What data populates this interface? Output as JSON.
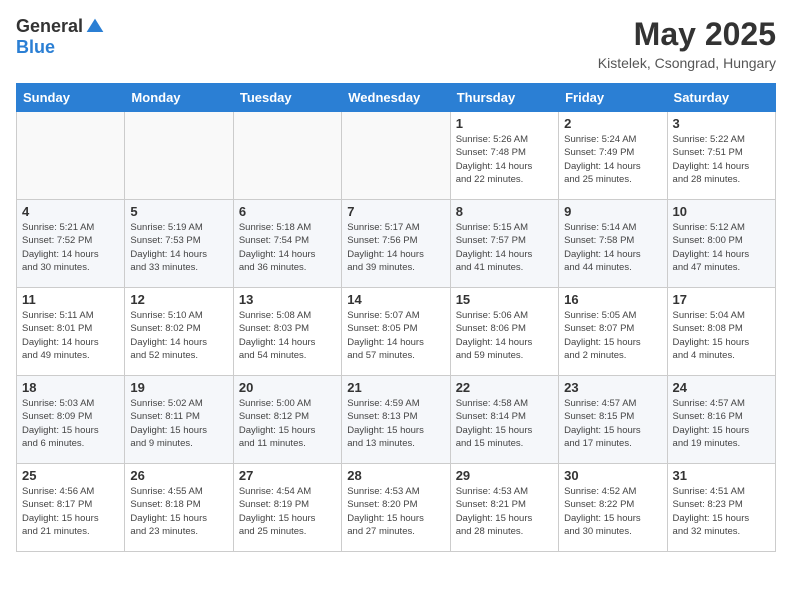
{
  "header": {
    "logo_general": "General",
    "logo_blue": "Blue",
    "month_title": "May 2025",
    "location": "Kistelek, Csongrad, Hungary"
  },
  "weekdays": [
    "Sunday",
    "Monday",
    "Tuesday",
    "Wednesday",
    "Thursday",
    "Friday",
    "Saturday"
  ],
  "weeks": [
    [
      {
        "day": "",
        "info": ""
      },
      {
        "day": "",
        "info": ""
      },
      {
        "day": "",
        "info": ""
      },
      {
        "day": "",
        "info": ""
      },
      {
        "day": "1",
        "info": "Sunrise: 5:26 AM\nSunset: 7:48 PM\nDaylight: 14 hours\nand 22 minutes."
      },
      {
        "day": "2",
        "info": "Sunrise: 5:24 AM\nSunset: 7:49 PM\nDaylight: 14 hours\nand 25 minutes."
      },
      {
        "day": "3",
        "info": "Sunrise: 5:22 AM\nSunset: 7:51 PM\nDaylight: 14 hours\nand 28 minutes."
      }
    ],
    [
      {
        "day": "4",
        "info": "Sunrise: 5:21 AM\nSunset: 7:52 PM\nDaylight: 14 hours\nand 30 minutes."
      },
      {
        "day": "5",
        "info": "Sunrise: 5:19 AM\nSunset: 7:53 PM\nDaylight: 14 hours\nand 33 minutes."
      },
      {
        "day": "6",
        "info": "Sunrise: 5:18 AM\nSunset: 7:54 PM\nDaylight: 14 hours\nand 36 minutes."
      },
      {
        "day": "7",
        "info": "Sunrise: 5:17 AM\nSunset: 7:56 PM\nDaylight: 14 hours\nand 39 minutes."
      },
      {
        "day": "8",
        "info": "Sunrise: 5:15 AM\nSunset: 7:57 PM\nDaylight: 14 hours\nand 41 minutes."
      },
      {
        "day": "9",
        "info": "Sunrise: 5:14 AM\nSunset: 7:58 PM\nDaylight: 14 hours\nand 44 minutes."
      },
      {
        "day": "10",
        "info": "Sunrise: 5:12 AM\nSunset: 8:00 PM\nDaylight: 14 hours\nand 47 minutes."
      }
    ],
    [
      {
        "day": "11",
        "info": "Sunrise: 5:11 AM\nSunset: 8:01 PM\nDaylight: 14 hours\nand 49 minutes."
      },
      {
        "day": "12",
        "info": "Sunrise: 5:10 AM\nSunset: 8:02 PM\nDaylight: 14 hours\nand 52 minutes."
      },
      {
        "day": "13",
        "info": "Sunrise: 5:08 AM\nSunset: 8:03 PM\nDaylight: 14 hours\nand 54 minutes."
      },
      {
        "day": "14",
        "info": "Sunrise: 5:07 AM\nSunset: 8:05 PM\nDaylight: 14 hours\nand 57 minutes."
      },
      {
        "day": "15",
        "info": "Sunrise: 5:06 AM\nSunset: 8:06 PM\nDaylight: 14 hours\nand 59 minutes."
      },
      {
        "day": "16",
        "info": "Sunrise: 5:05 AM\nSunset: 8:07 PM\nDaylight: 15 hours\nand 2 minutes."
      },
      {
        "day": "17",
        "info": "Sunrise: 5:04 AM\nSunset: 8:08 PM\nDaylight: 15 hours\nand 4 minutes."
      }
    ],
    [
      {
        "day": "18",
        "info": "Sunrise: 5:03 AM\nSunset: 8:09 PM\nDaylight: 15 hours\nand 6 minutes."
      },
      {
        "day": "19",
        "info": "Sunrise: 5:02 AM\nSunset: 8:11 PM\nDaylight: 15 hours\nand 9 minutes."
      },
      {
        "day": "20",
        "info": "Sunrise: 5:00 AM\nSunset: 8:12 PM\nDaylight: 15 hours\nand 11 minutes."
      },
      {
        "day": "21",
        "info": "Sunrise: 4:59 AM\nSunset: 8:13 PM\nDaylight: 15 hours\nand 13 minutes."
      },
      {
        "day": "22",
        "info": "Sunrise: 4:58 AM\nSunset: 8:14 PM\nDaylight: 15 hours\nand 15 minutes."
      },
      {
        "day": "23",
        "info": "Sunrise: 4:57 AM\nSunset: 8:15 PM\nDaylight: 15 hours\nand 17 minutes."
      },
      {
        "day": "24",
        "info": "Sunrise: 4:57 AM\nSunset: 8:16 PM\nDaylight: 15 hours\nand 19 minutes."
      }
    ],
    [
      {
        "day": "25",
        "info": "Sunrise: 4:56 AM\nSunset: 8:17 PM\nDaylight: 15 hours\nand 21 minutes."
      },
      {
        "day": "26",
        "info": "Sunrise: 4:55 AM\nSunset: 8:18 PM\nDaylight: 15 hours\nand 23 minutes."
      },
      {
        "day": "27",
        "info": "Sunrise: 4:54 AM\nSunset: 8:19 PM\nDaylight: 15 hours\nand 25 minutes."
      },
      {
        "day": "28",
        "info": "Sunrise: 4:53 AM\nSunset: 8:20 PM\nDaylight: 15 hours\nand 27 minutes."
      },
      {
        "day": "29",
        "info": "Sunrise: 4:53 AM\nSunset: 8:21 PM\nDaylight: 15 hours\nand 28 minutes."
      },
      {
        "day": "30",
        "info": "Sunrise: 4:52 AM\nSunset: 8:22 PM\nDaylight: 15 hours\nand 30 minutes."
      },
      {
        "day": "31",
        "info": "Sunrise: 4:51 AM\nSunset: 8:23 PM\nDaylight: 15 hours\nand 32 minutes."
      }
    ]
  ]
}
